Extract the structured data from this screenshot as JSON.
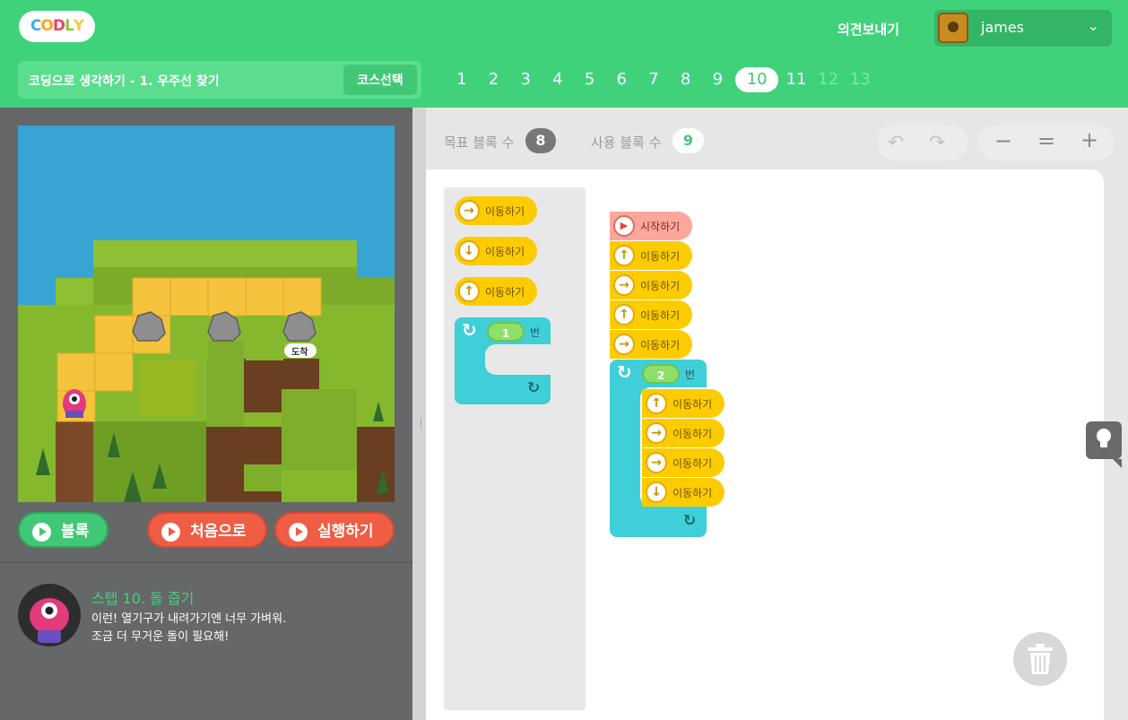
{
  "header": {
    "logo": "CODLY",
    "feedback": "의견보내기",
    "username": "james",
    "course_title": "코딩으로 생각하기 - 1. 우주선 찾기",
    "course_select": "코스선택"
  },
  "steps": {
    "items": [
      "1",
      "2",
      "3",
      "4",
      "5",
      "6",
      "7",
      "8",
      "9",
      "10",
      "11",
      "12",
      "13"
    ],
    "current": "10",
    "locked": [
      "12",
      "13"
    ]
  },
  "scene": {
    "goal_label": "도착"
  },
  "controls": {
    "block_label": "블록",
    "reset_label": "처음으로",
    "run_label": "실행하기"
  },
  "mission": {
    "title": "스텝 10. 돌 줍기",
    "line1": "이런! 열기구가 내려가기엔 너무 가벼워.",
    "line2": "조금 더 무거운 돌이 필요해!"
  },
  "workspace_header": {
    "goal_blocks_label": "목표 블록 수",
    "goal_blocks_count": "8",
    "used_blocks_label": "사용 블록 수",
    "used_blocks_count": "9"
  },
  "palette": {
    "blocks": [
      {
        "icon": "arrow-right-icon",
        "glyph": "→",
        "label": "이동하기"
      },
      {
        "icon": "arrow-down-icon",
        "glyph": "↓",
        "label": "이동하기"
      },
      {
        "icon": "arrow-up-icon",
        "glyph": "↑",
        "label": "이동하기"
      }
    ],
    "loop": {
      "count": "1",
      "label": "번"
    }
  },
  "program": {
    "start_label": "시작하기",
    "steps": [
      {
        "icon": "arrow-up-icon",
        "glyph": "↑",
        "label": "이동하기"
      },
      {
        "icon": "arrow-right-icon",
        "glyph": "→",
        "label": "이동하기"
      },
      {
        "icon": "arrow-up-icon",
        "glyph": "↑",
        "label": "이동하기"
      },
      {
        "icon": "arrow-right-icon",
        "glyph": "→",
        "label": "이동하기"
      }
    ],
    "loop": {
      "count": "2",
      "label": "번",
      "steps": [
        {
          "icon": "arrow-up-icon",
          "glyph": "↑",
          "label": "이동하기"
        },
        {
          "icon": "arrow-right-icon",
          "glyph": "→",
          "label": "이동하기"
        },
        {
          "icon": "arrow-right-icon",
          "glyph": "→",
          "label": "이동하기"
        },
        {
          "icon": "arrow-down-icon",
          "glyph": "↓",
          "label": "이동하기"
        }
      ]
    }
  },
  "colors": {
    "brand_green": "#40d27a",
    "move_block": "#fdcc00",
    "loop_block": "#3ecfd8",
    "start_block": "#fca79c",
    "action_red": "#ee5d44"
  }
}
